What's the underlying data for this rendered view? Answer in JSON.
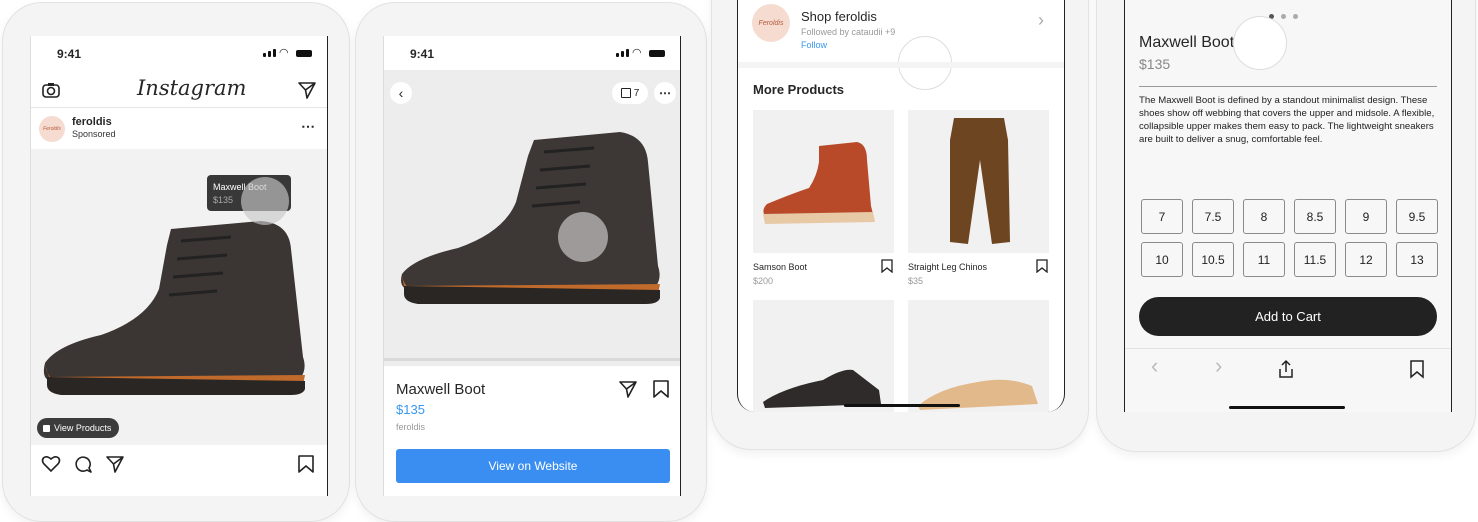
{
  "screen1": {
    "time": "9:41",
    "app_title": "Instagram",
    "account_name": "feroldis",
    "sponsored_label": "Sponsored",
    "avatar_text": "Feroldis",
    "tag_name": "Maxwell Boot",
    "tag_price": "$135",
    "view_products_label": "View Products"
  },
  "screen2": {
    "time": "9:41",
    "bag_count": "7",
    "product_title": "Maxwell Boot",
    "product_price": "$135",
    "seller": "feroldis",
    "cta_label": "View on Website"
  },
  "screen3": {
    "shop_title": "Shop feroldis",
    "followed_by": "Followed by cataudii +9",
    "follow_label": "Follow",
    "avatar_text": "Feroldis",
    "section_title": "More Products",
    "products": [
      {
        "name": "Samson Boot",
        "price": "$200"
      },
      {
        "name": "Straight Leg Chinos",
        "price": "$35"
      }
    ]
  },
  "screen4": {
    "product_title": "Maxwell Boot",
    "product_price": "$135",
    "description": "The Maxwell Boot is defined by a standout minimalist design. These shoes show off webbing that covers the upper and midsole. A flexible, collapsible upper makes them easy to pack. The lightweight sneakers are built to deliver a snug, comfortable feel.",
    "sizes_row1": [
      "7",
      "7.5",
      "8",
      "8.5",
      "9",
      "9.5"
    ],
    "sizes_row2": [
      "10",
      "10.5",
      "11",
      "11.5",
      "12",
      "13"
    ],
    "add_to_cart_label": "Add to Cart"
  },
  "colors": {
    "instagram_blue": "#3897f0",
    "cta_blue": "#3a8ef2",
    "cart_dark": "#222222"
  }
}
